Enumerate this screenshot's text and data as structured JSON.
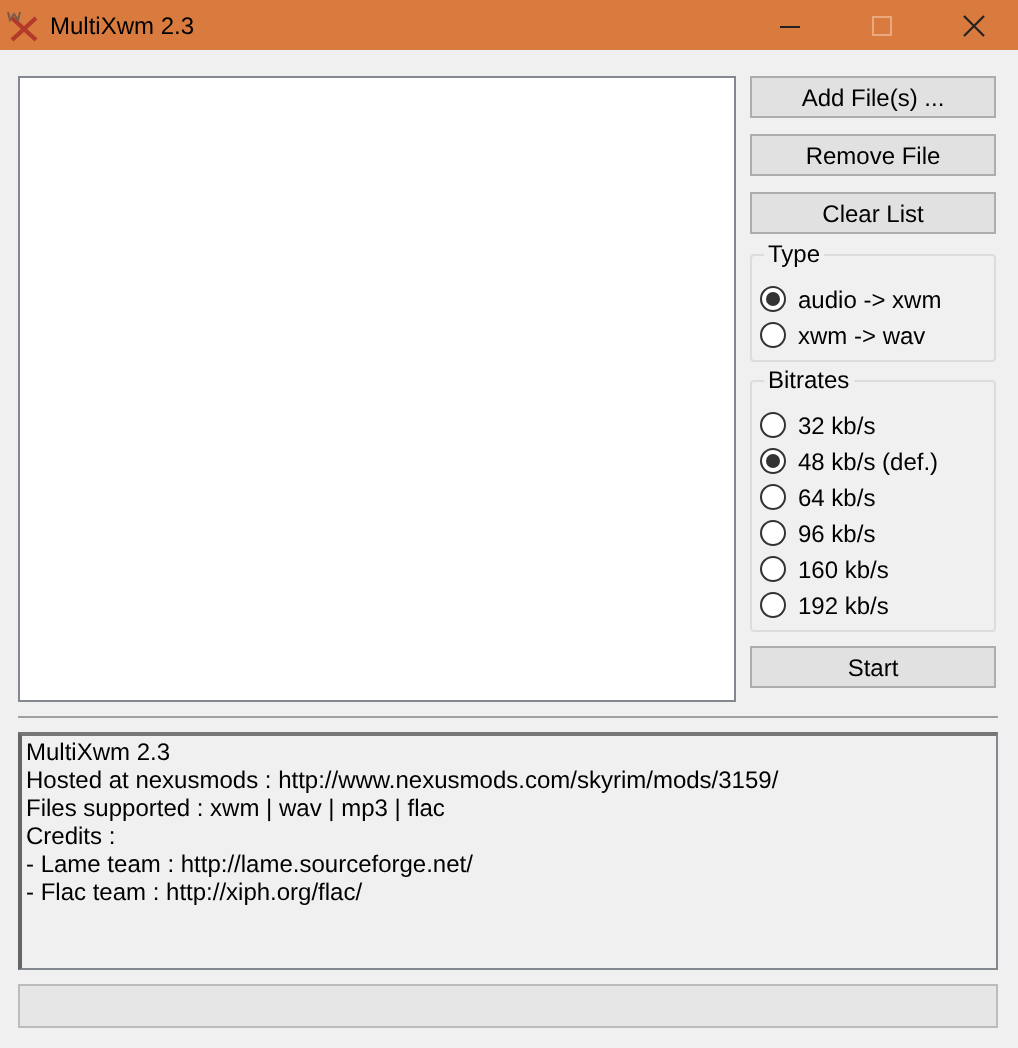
{
  "window": {
    "title": "MultiXwm 2.3",
    "maximize_disabled": true
  },
  "buttons": [
    {
      "label": "Add File(s) ..."
    },
    {
      "label": "Remove File"
    },
    {
      "label": "Clear List"
    }
  ],
  "type_group": {
    "title": "Type",
    "options": [
      {
        "label": "audio -> xwm",
        "selected": true
      },
      {
        "label": "xwm -> wav",
        "selected": false
      }
    ]
  },
  "bitrates_group": {
    "title": "Bitrates",
    "options": [
      {
        "label": "32 kb/s",
        "selected": false
      },
      {
        "label": "48 kb/s (def.)",
        "selected": true
      },
      {
        "label": "64 kb/s",
        "selected": false
      },
      {
        "label": "96 kb/s",
        "selected": false
      },
      {
        "label": "160 kb/s",
        "selected": false
      },
      {
        "label": "192 kb/s",
        "selected": false
      }
    ]
  },
  "start_button": {
    "label": "Start"
  },
  "log": {
    "lines": [
      "MultiXwm 2.3",
      "Hosted at nexusmods : http://www.nexusmods.com/skyrim/mods/3159/",
      "Files supported : xwm | wav | mp3 | flac",
      "Credits :",
      "- Lame team : http://lame.sourceforge.net/",
      "- Flac team : http://xiph.org/flac/"
    ]
  }
}
